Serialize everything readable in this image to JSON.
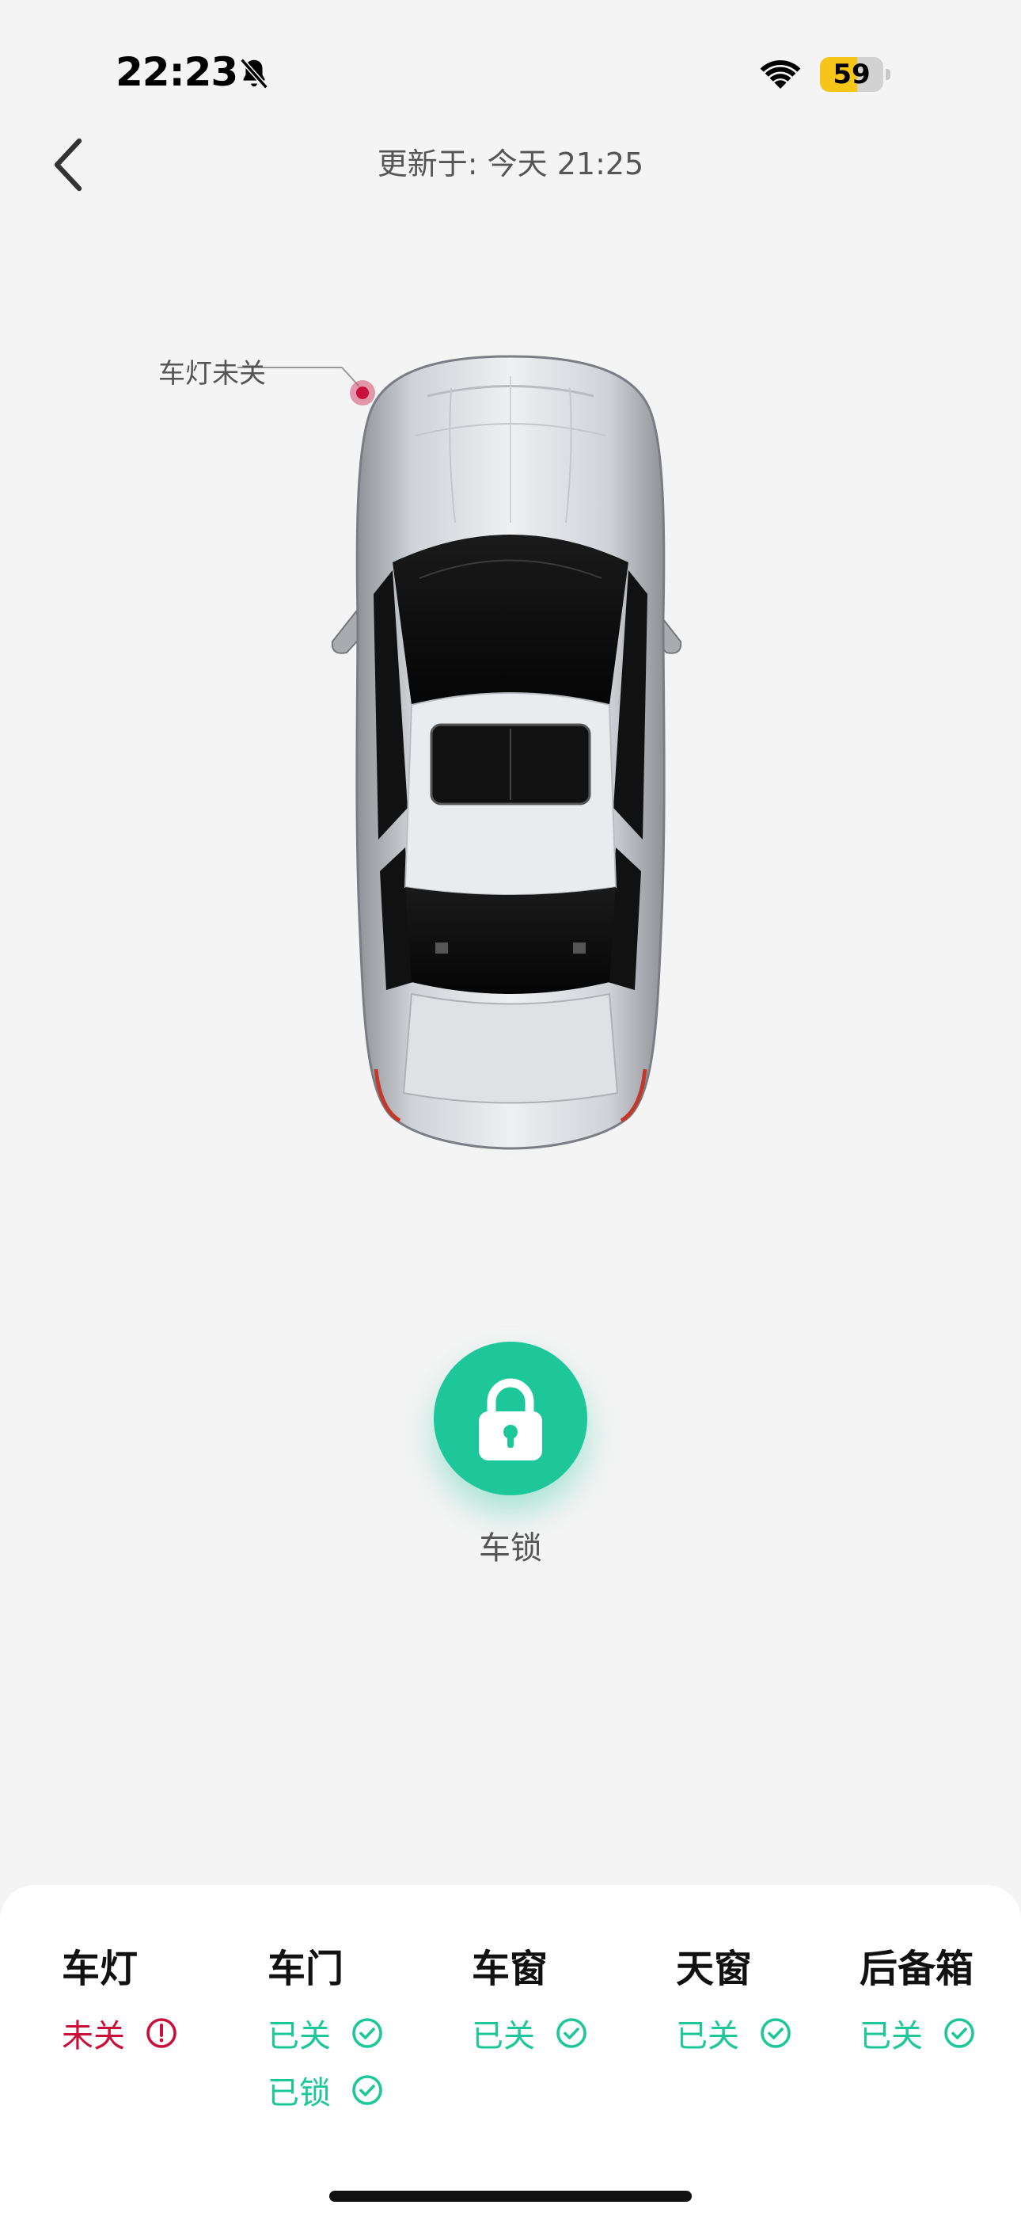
{
  "status_bar": {
    "time": "22:23",
    "battery_level": "59",
    "battery_fraction": 0.59,
    "icons": [
      "bell-slash-icon",
      "wifi-icon",
      "battery-icon"
    ]
  },
  "nav": {
    "back_icon": "chevron-left-icon",
    "updated_text": "更新于: 今天 21:25"
  },
  "car": {
    "callout_label": "车灯未关"
  },
  "lock": {
    "label": "车锁",
    "icon": "lock-icon",
    "color": "#1dc79a"
  },
  "colors": {
    "ok": "#1dc79a",
    "warn": "#c8103a"
  },
  "status_panel": {
    "items": [
      {
        "title": "车灯",
        "states": [
          {
            "text": "未关",
            "type": "warn",
            "icon": "alert-circle-icon"
          }
        ]
      },
      {
        "title": "车门",
        "states": [
          {
            "text": "已关",
            "type": "ok",
            "icon": "check-circle-icon"
          },
          {
            "text": "已锁",
            "type": "ok",
            "icon": "check-circle-icon"
          }
        ]
      },
      {
        "title": "车窗",
        "states": [
          {
            "text": "已关",
            "type": "ok",
            "icon": "check-circle-icon"
          }
        ]
      },
      {
        "title": "天窗",
        "states": [
          {
            "text": "已关",
            "type": "ok",
            "icon": "check-circle-icon"
          }
        ]
      },
      {
        "title": "后备箱",
        "states": [
          {
            "text": "已关",
            "type": "ok",
            "icon": "check-circle-icon"
          }
        ]
      }
    ]
  }
}
